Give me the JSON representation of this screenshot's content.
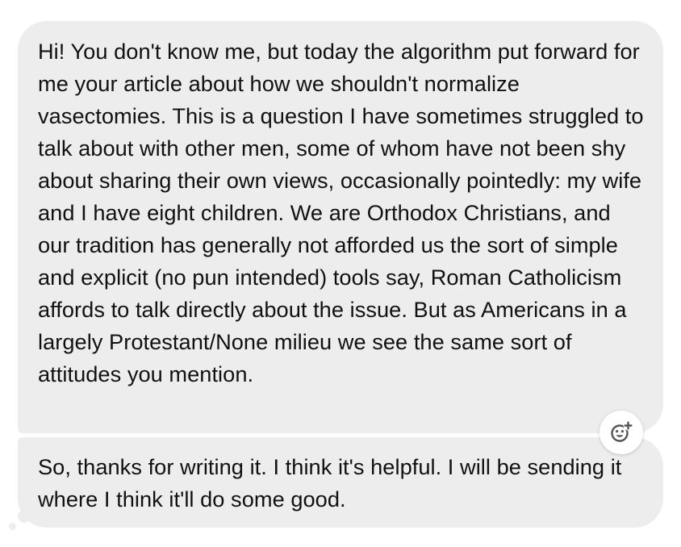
{
  "messages": [
    {
      "text": "Hi! You don't know me, but today the algorithm put forward for me your article about how we shouldn't normalize vasectomies. This is a question I have sometimes struggled to talk about with other men, some of whom have not been shy about sharing their own views, occasionally pointedly: my wife and I have eight children. We are Orthodox Christians, and our tradition has generally not afforded us the sort of simple and explicit (no pun intended) tools say, Roman Catholicism affords to talk directly about the issue. But as Americans in a largely Protestant/None milieu we see the same sort of attitudes you mention."
    },
    {
      "text": "So, thanks for writing it. I think it's helpful. I will be sending it where I think it'll do some good."
    }
  ],
  "reaction_button": {
    "icon": "add-reaction-icon"
  },
  "colors": {
    "bubble_background": "#ededed",
    "text": "#111111",
    "page_background": "#ffffff",
    "icon": "#555555"
  }
}
